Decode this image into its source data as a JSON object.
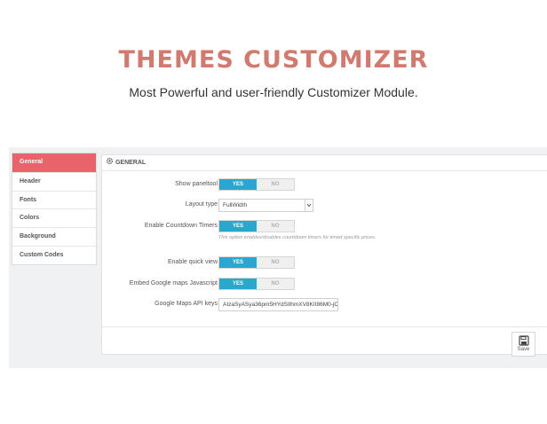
{
  "hero": {
    "title": "THEMES CUSTOMIZER",
    "subtitle": "Most Powerful and user-friendly Customizer Module."
  },
  "sidebar": {
    "items": [
      {
        "label": "General",
        "active": true
      },
      {
        "label": "Header"
      },
      {
        "label": "Fonts"
      },
      {
        "label": "Colors"
      },
      {
        "label": "Background"
      },
      {
        "label": "Custom Codes"
      }
    ]
  },
  "panel": {
    "heading": "GENERAL",
    "heading_icon": "gear-icon",
    "fields": {
      "show_paneltool": {
        "label": "Show paneltool",
        "yes": "YES",
        "no": "NO",
        "value": "YES"
      },
      "layout_type": {
        "label": "Layout type",
        "value": "FullWidth"
      },
      "countdown": {
        "label": "Enable Countdown Timers",
        "yes": "YES",
        "no": "NO",
        "value": "YES",
        "help": "This option enables/disables countdown timers for timed specific prices."
      },
      "quick_view": {
        "label": "Enable quick view",
        "yes": "YES",
        "no": "NO",
        "value": "YES"
      },
      "google_maps_js": {
        "label": "Embed Google maps Javascript",
        "yes": "YES",
        "no": "NO",
        "value": "YES"
      },
      "google_maps_key": {
        "label": "Google Maps API keys",
        "value": "AIzaSyASya36pm5HYdSIlhmXV8KII86M0-jC"
      }
    },
    "save_label": "Save",
    "save_icon": "floppy-disk-icon"
  },
  "colors": {
    "accent_title": "#d17a6f",
    "active_nav": "#e9636b",
    "toggle_on": "#29a7cc"
  }
}
